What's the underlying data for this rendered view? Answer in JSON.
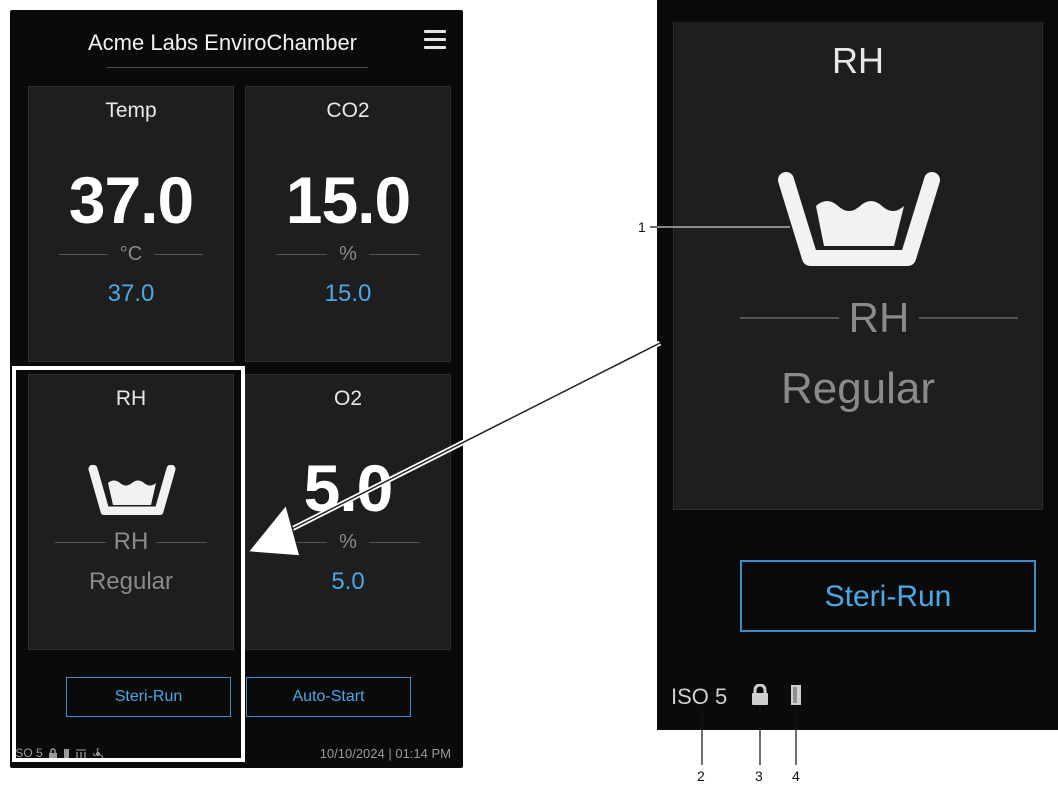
{
  "header": {
    "title": "Acme Labs EnviroChamber",
    "menu_icon": "hamburger-menu-icon"
  },
  "tiles": {
    "temp": {
      "label": "Temp",
      "value": "37.0",
      "unit": "°C",
      "setpoint": "37.0"
    },
    "co2": {
      "label": "CO2",
      "value": "15.0",
      "unit": "%",
      "setpoint": "15.0"
    },
    "rh": {
      "label": "RH",
      "icon": "humidity-pan-icon",
      "sub_label": "RH",
      "mode": "Regular"
    },
    "o2": {
      "label": "O2",
      "value": "5.0",
      "unit": "%",
      "setpoint": "5.0"
    }
  },
  "buttons": {
    "steri_run": "Steri-Run",
    "auto_start": "Auto-Start"
  },
  "status_bar": {
    "iso": "ISO 5",
    "datetime": "10/10/2024 | 01:14 PM",
    "icons": [
      "lock-icon",
      "door-icon",
      "heat-icon",
      "fan-icon"
    ]
  },
  "zoom": {
    "label": "RH",
    "sub_label": "RH",
    "mode": "Regular",
    "button": "Steri-Run",
    "iso": "ISO 5",
    "callouts": [
      "1",
      "2",
      "3",
      "4"
    ]
  },
  "colors": {
    "accent": "#4aa8e8",
    "background": "#0a0a0a",
    "tile": "#1e1e1e",
    "muted": "#8a8a8a"
  }
}
